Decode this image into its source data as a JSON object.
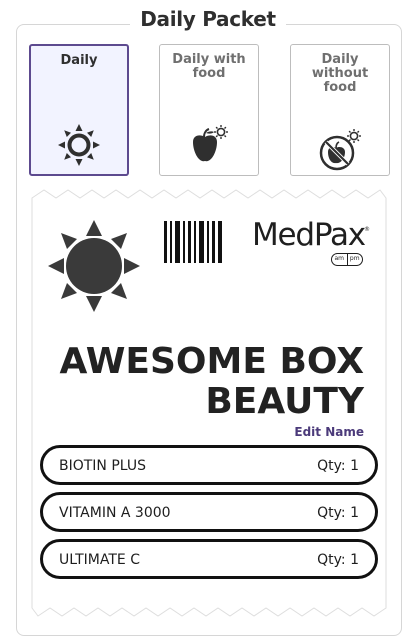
{
  "header": {
    "title": "Daily Packet"
  },
  "options": [
    {
      "label_line1": "Daily",
      "label_line2": "",
      "label_line3": "",
      "icon": "sun-icon",
      "selected": true
    },
    {
      "label_line1": "Daily with",
      "label_line2": "food",
      "label_line3": "",
      "icon": "apple-sun-icon",
      "selected": false
    },
    {
      "label_line1": "Daily",
      "label_line2": "without",
      "label_line3": "food",
      "icon": "no-food-icon",
      "selected": false
    }
  ],
  "packet": {
    "brand": "MedPax",
    "brand_mark": "®",
    "am": "am",
    "pm": "pm",
    "name_line1": "AWESOME BOX",
    "name_line2": "BEAUTY",
    "edit_label": "Edit Name",
    "items": [
      {
        "name": "BIOTIN PLUS",
        "qty": "Qty: 1"
      },
      {
        "name": "VITAMIN A 3000",
        "qty": "Qty: 1"
      },
      {
        "name": "ULTIMATE C",
        "qty": "Qty: 1"
      }
    ]
  },
  "colors": {
    "accent": "#5d4a8f",
    "selected_bg": "#f2f3ff",
    "link": "#4b3a7a",
    "border": "#bdbdbd"
  }
}
